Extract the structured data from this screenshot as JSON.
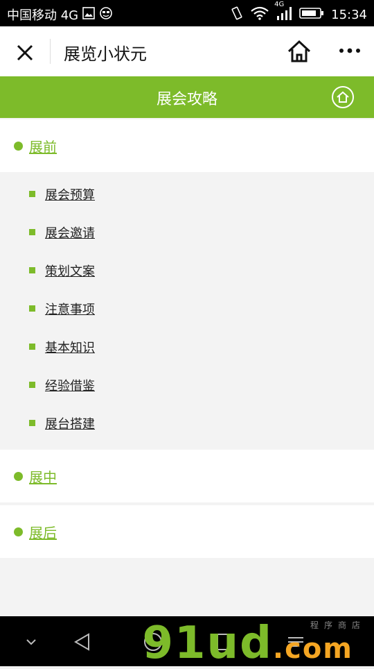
{
  "statusbar": {
    "carrier": "中国移动 4G",
    "time": "15:34",
    "network": "4G"
  },
  "titlebar": {
    "title": "展览小状元"
  },
  "header": {
    "title": "展会攻略"
  },
  "sections": [
    {
      "label": "展前",
      "items": [
        "展会预算",
        "展会邀请",
        "策划文案",
        "注意事项",
        "基本知识",
        "经验借鉴",
        "展台搭建"
      ]
    },
    {
      "label": "展中"
    },
    {
      "label": "展后"
    }
  ],
  "watermark": {
    "main": "91ud",
    "suffix": ".com",
    "tagline": "程序商店"
  },
  "colors": {
    "accent": "#7dbb2a",
    "background": "#f3f3f3",
    "navbar": "#000000"
  }
}
